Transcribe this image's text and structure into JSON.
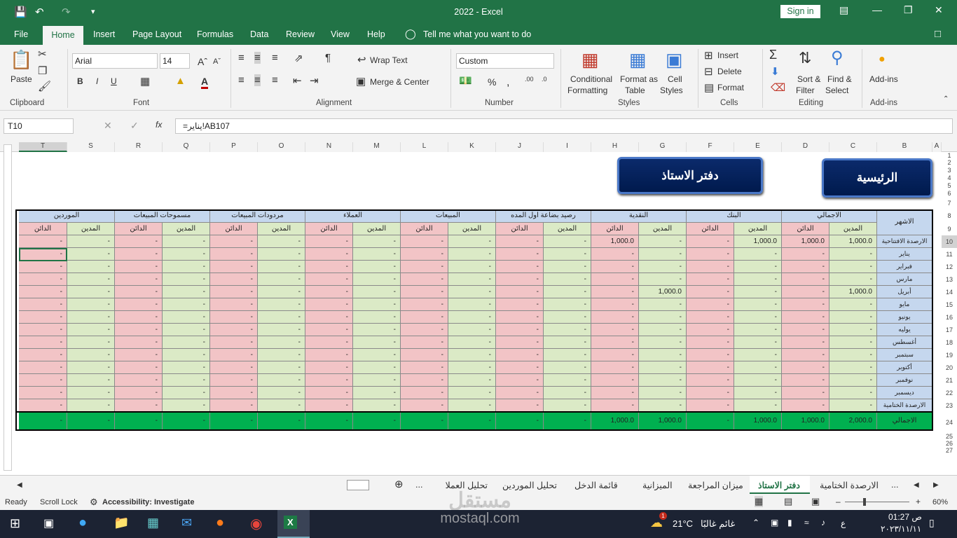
{
  "window": {
    "title": "2022  -  Excel",
    "sign_in": "Sign in"
  },
  "menu": [
    "File",
    "Home",
    "Insert",
    "Page Layout",
    "Formulas",
    "Data",
    "Review",
    "View",
    "Help"
  ],
  "tell_me": "Tell me what you want to do",
  "ribbon": {
    "clipboard": {
      "paste": "Paste",
      "group": "Clipboard"
    },
    "font": {
      "name": "Arial",
      "size": "14",
      "group": "Font"
    },
    "alignment": {
      "wrap": "Wrap Text",
      "merge": "Merge & Center",
      "group": "Alignment"
    },
    "number": {
      "format": "Custom",
      "group": "Number"
    },
    "styles": {
      "cond1": "Conditional",
      "cond2": "Formatting",
      "fmt1": "Format as",
      "fmt2": "Table",
      "cell1": "Cell",
      "cell2": "Styles",
      "group": "Styles"
    },
    "cells": {
      "insert": "Insert",
      "delete": "Delete",
      "format": "Format",
      "group": "Cells"
    },
    "editing": {
      "sort1": "Sort &",
      "sort2": "Filter",
      "find1": "Find &",
      "find2": "Select",
      "group": "Editing"
    },
    "addins": {
      "label": "Add-ins",
      "group": "Add-ins"
    }
  },
  "formula_bar": {
    "name_box": "T10",
    "formula": "=يناير!AB107"
  },
  "columns": [
    "T",
    "S",
    "R",
    "Q",
    "P",
    "O",
    "N",
    "M",
    "L",
    "K",
    "J",
    "I",
    "H",
    "G",
    "F",
    "E",
    "D",
    "C",
    "B",
    "A"
  ],
  "rows": [
    "1",
    "2",
    "3",
    "4",
    "5",
    "6",
    "7",
    "8",
    "9",
    "10",
    "11",
    "12",
    "13",
    "14",
    "15",
    "16",
    "17",
    "18",
    "19",
    "20",
    "21",
    "22",
    "23",
    "24",
    "25",
    "26",
    "27"
  ],
  "buttons": {
    "home": "الرئيسية",
    "ledger": "دفتر الاستاذ"
  },
  "table": {
    "groups": [
      "الموردين",
      "مسموحات المبيعات",
      "مردودات المبيعات",
      "العملاء",
      "المبيعات",
      "رصيد بضاعة اول المده",
      "النقدية",
      "البنك",
      "الاجمالي"
    ],
    "sub": {
      "credit": "الدائن",
      "debit": "المدين"
    },
    "month_header": "الاشهر",
    "months": [
      "الارصدة الافتتاحية",
      "يناير",
      "فبراير",
      "مارس",
      "أبريل",
      "مايو",
      "يونيو",
      "يوليه",
      "أغسطس",
      "سبتمبر",
      "أكتوبر",
      "نوفمبر",
      "ديسمبر",
      "الارصدة الختامية"
    ],
    "total_label": "الاجمالي",
    "dash": "-",
    "special": {
      "opening": {
        "H": "1,000.0",
        "E": "1,000.0",
        "D": "1,000.0",
        "C": "1,000.0"
      },
      "april": {
        "G": "1,000.0",
        "C": "1,000.0"
      },
      "total": {
        "H": "1,000.0",
        "G": "1,000.0",
        "E": "1,000.0",
        "D": "1,000.0",
        "C": "2,000.0"
      }
    }
  },
  "sheet_tabs": [
    "الارصدة الختامية",
    "دفتر الاستاذ",
    "ميزان المراجعة",
    "الميزانية",
    "قائمة  الدخل",
    "تحليل الموردين",
    "تحليل العملا"
  ],
  "status": {
    "ready": "Ready",
    "scroll": "Scroll Lock",
    "access": "Accessibility: Investigate",
    "zoom": "60%"
  },
  "watermark": {
    "line1": "مستقل",
    "line2": "mostaql.com"
  },
  "taskbar": {
    "weather": "21°C",
    "weather_text": "غائم غالبًا",
    "lang": "ع",
    "time": "01:27 ص",
    "date": "٢٠٢٣/١١/١١",
    "badge": "1"
  }
}
